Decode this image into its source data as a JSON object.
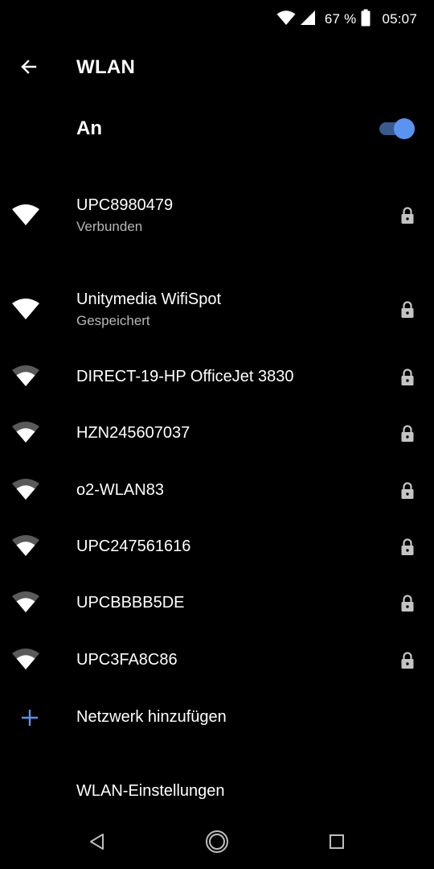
{
  "status_bar": {
    "battery_percent": "67 %",
    "battery_level": 0.67,
    "time": "05:07",
    "icons": [
      "wifi-signal-icon",
      "cell-signal-icon",
      "battery-icon"
    ]
  },
  "header": {
    "back_icon": "arrow-left-icon",
    "title": "WLAN"
  },
  "wlan_toggle": {
    "label": "An",
    "checked": true,
    "accent_color": "#5a93f0"
  },
  "networks": [
    {
      "ssid": "UPC8980479",
      "status": "Verbunden",
      "signal": "strong",
      "secured": true
    },
    {
      "ssid": "Unitymedia WifiSpot",
      "status": "Gespeichert",
      "signal": "strong",
      "secured": true
    },
    {
      "ssid": "DIRECT-19-HP OfficeJet 3830",
      "status": "",
      "signal": "medium",
      "secured": true
    },
    {
      "ssid": "HZN245607037",
      "status": "",
      "signal": "medium",
      "secured": true
    },
    {
      "ssid": "o2-WLAN83",
      "status": "",
      "signal": "medium",
      "secured": true
    },
    {
      "ssid": "UPC247561616",
      "status": "",
      "signal": "medium",
      "secured": true
    },
    {
      "ssid": "UPCBBBB5DE",
      "status": "",
      "signal": "medium",
      "secured": true
    },
    {
      "ssid": "UPC3FA8C86",
      "status": "",
      "signal": "medium",
      "secured": true
    }
  ],
  "add_network": {
    "label": "Netzwerk hinzufügen",
    "icon": "plus-icon",
    "icon_color": "#5a93f0"
  },
  "settings_link": {
    "label": "WLAN-Einstellungen"
  },
  "nav_bar": {
    "icons": [
      "nav-back-icon",
      "nav-home-icon",
      "nav-recents-icon"
    ]
  }
}
